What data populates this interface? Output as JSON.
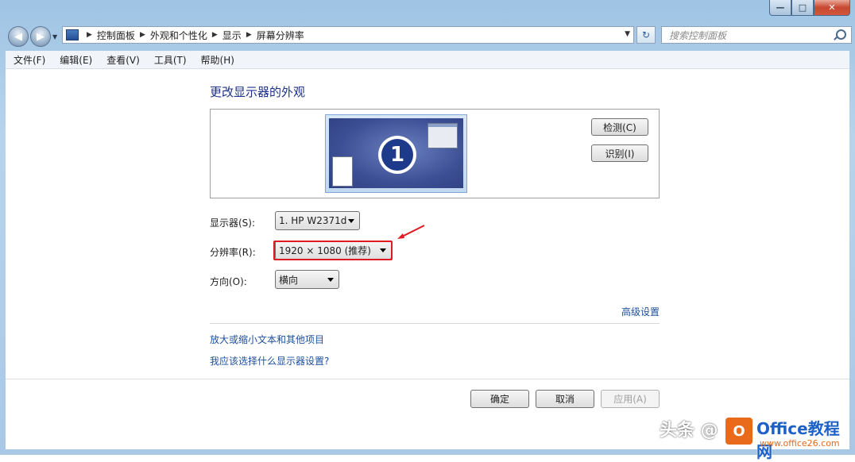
{
  "window": {
    "caption": {
      "minimize": "—",
      "maximize": "□",
      "close": "✕"
    }
  },
  "nav": {
    "back_glyph": "◀",
    "forward_glyph": "▶",
    "breadcrumbs": [
      "控制面板",
      "外观和个性化",
      "显示",
      "屏幕分辨率"
    ],
    "search_placeholder": "搜索控制面板"
  },
  "menu": [
    "文件(F)",
    "编辑(E)",
    "查看(V)",
    "工具(T)",
    "帮助(H)"
  ],
  "main": {
    "heading": "更改显示器的外观",
    "monitor_number": "1",
    "detect_label": "检测(C)",
    "identify_label": "识别(I)",
    "display_label": "显示器(S):",
    "display_value": "1. HP W2371d",
    "resolution_label": "分辨率(R):",
    "resolution_value": "1920 × 1080 (推荐)",
    "orientation_label": "方向(O):",
    "orientation_value": "横向",
    "advanced_link": "高级设置",
    "link_text_size": "放大或缩小文本和其他项目",
    "link_which_settings": "我应该选择什么显示器设置?"
  },
  "buttons": {
    "ok": "确定",
    "cancel": "取消",
    "apply": "应用(A)"
  },
  "watermark": {
    "left": "头条 @",
    "brand": "Office教程网",
    "url": "www.office26.com",
    "logo_letter": "O"
  },
  "colors": {
    "highlight": "#e01a22",
    "link": "#1e4f9c",
    "heading": "#1e3287"
  }
}
